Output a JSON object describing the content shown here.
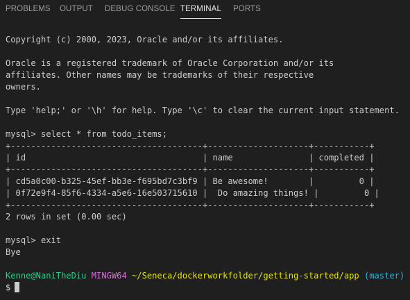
{
  "tabs": [
    {
      "label": "PROBLEMS",
      "active": false
    },
    {
      "label": "OUTPUT",
      "active": false
    },
    {
      "label": "DEBUG CONSOLE",
      "active": false
    },
    {
      "label": "TERMINAL",
      "active": true
    },
    {
      "label": "PORTS",
      "active": false
    }
  ],
  "terminal": {
    "lines": {
      "copyright": "Copyright (c) 2000, 2023, Oracle and/or its affiliates.",
      "trademark_1": "Oracle is a registered trademark of Oracle Corporation and/or its",
      "trademark_2": "affiliates. Other names may be trademarks of their respective",
      "trademark_3": "owners.",
      "help": "Type 'help;' or '\\h' for help. Type '\\c' to clear the current input statement.",
      "query": "mysql> select * from todo_items;",
      "border_top": "+--------------------------------------+--------------------+-----------+",
      "header_row": "| id                                   | name               | completed |",
      "border_mid": "+--------------------------------------+--------------------+-----------+",
      "row_1": "| cd5a0c00-b325-45ef-bb3e-f695bd7c3bf9 | Be awesome!        |         0 |",
      "row_2": "| 0f72e9f4-85f6-4334-a5e6-16e503715610 |  Do amazing things! |         0 |",
      "border_bottom": "+--------------------------------------+--------------------+-----------+",
      "rows_in_set": "2 rows in set (0.00 sec)",
      "exit_cmd": "mysql> exit",
      "bye": "Bye"
    },
    "prompt": {
      "user_host": "Kenne@NaniTheDiu",
      "shell": "MINGW64",
      "path": "~/Seneca/dockerworkfolder/getting-started/app",
      "branch": "(master)",
      "symbol": "$"
    },
    "colors": {
      "background": "#1f1f1f",
      "foreground": "#cccccc",
      "user_host": "#23d18b",
      "shell": "#d670d6",
      "path": "#e5e510",
      "branch": "#29b8db"
    }
  }
}
